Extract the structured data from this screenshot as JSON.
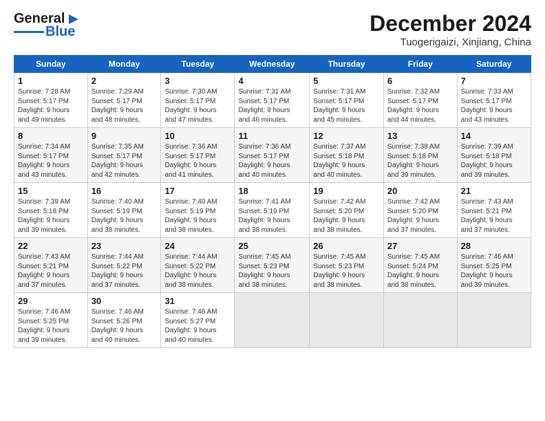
{
  "header": {
    "logo_general": "General",
    "logo_blue": "Blue",
    "title": "December 2024",
    "subtitle": "Tuogerigaizi, Xinjiang, China"
  },
  "calendar": {
    "days_of_week": [
      "Sunday",
      "Monday",
      "Tuesday",
      "Wednesday",
      "Thursday",
      "Friday",
      "Saturday"
    ],
    "weeks": [
      [
        {
          "day": "1",
          "info": "Sunrise: 7:28 AM\nSunset: 5:17 PM\nDaylight: 9 hours\nand 49 minutes."
        },
        {
          "day": "2",
          "info": "Sunrise: 7:29 AM\nSunset: 5:17 PM\nDaylight: 9 hours\nand 48 minutes."
        },
        {
          "day": "3",
          "info": "Sunrise: 7:30 AM\nSunset: 5:17 PM\nDaylight: 9 hours\nand 47 minutes."
        },
        {
          "day": "4",
          "info": "Sunrise: 7:31 AM\nSunset: 5:17 PM\nDaylight: 9 hours\nand 46 minutes."
        },
        {
          "day": "5",
          "info": "Sunrise: 7:31 AM\nSunset: 5:17 PM\nDaylight: 9 hours\nand 45 minutes."
        },
        {
          "day": "6",
          "info": "Sunrise: 7:32 AM\nSunset: 5:17 PM\nDaylight: 9 hours\nand 44 minutes."
        },
        {
          "day": "7",
          "info": "Sunrise: 7:33 AM\nSunset: 5:17 PM\nDaylight: 9 hours\nand 43 minutes."
        }
      ],
      [
        {
          "day": "8",
          "info": "Sunrise: 7:34 AM\nSunset: 5:17 PM\nDaylight: 9 hours\nand 43 minutes."
        },
        {
          "day": "9",
          "info": "Sunrise: 7:35 AM\nSunset: 5:17 PM\nDaylight: 9 hours\nand 42 minutes."
        },
        {
          "day": "10",
          "info": "Sunrise: 7:36 AM\nSunset: 5:17 PM\nDaylight: 9 hours\nand 41 minutes."
        },
        {
          "day": "11",
          "info": "Sunrise: 7:36 AM\nSunset: 5:17 PM\nDaylight: 9 hours\nand 40 minutes."
        },
        {
          "day": "12",
          "info": "Sunrise: 7:37 AM\nSunset: 5:18 PM\nDaylight: 9 hours\nand 40 minutes."
        },
        {
          "day": "13",
          "info": "Sunrise: 7:38 AM\nSunset: 5:18 PM\nDaylight: 9 hours\nand 39 minutes."
        },
        {
          "day": "14",
          "info": "Sunrise: 7:39 AM\nSunset: 5:18 PM\nDaylight: 9 hours\nand 39 minutes."
        }
      ],
      [
        {
          "day": "15",
          "info": "Sunrise: 7:39 AM\nSunset: 5:18 PM\nDaylight: 9 hours\nand 39 minutes."
        },
        {
          "day": "16",
          "info": "Sunrise: 7:40 AM\nSunset: 5:19 PM\nDaylight: 9 hours\nand 38 minutes."
        },
        {
          "day": "17",
          "info": "Sunrise: 7:40 AM\nSunset: 5:19 PM\nDaylight: 9 hours\nand 38 minutes."
        },
        {
          "day": "18",
          "info": "Sunrise: 7:41 AM\nSunset: 5:19 PM\nDaylight: 9 hours\nand 38 minutes."
        },
        {
          "day": "19",
          "info": "Sunrise: 7:42 AM\nSunset: 5:20 PM\nDaylight: 9 hours\nand 38 minutes."
        },
        {
          "day": "20",
          "info": "Sunrise: 7:42 AM\nSunset: 5:20 PM\nDaylight: 9 hours\nand 37 minutes."
        },
        {
          "day": "21",
          "info": "Sunrise: 7:43 AM\nSunset: 5:21 PM\nDaylight: 9 hours\nand 37 minutes."
        }
      ],
      [
        {
          "day": "22",
          "info": "Sunrise: 7:43 AM\nSunset: 5:21 PM\nDaylight: 9 hours\nand 37 minutes."
        },
        {
          "day": "23",
          "info": "Sunrise: 7:44 AM\nSunset: 5:22 PM\nDaylight: 9 hours\nand 37 minutes."
        },
        {
          "day": "24",
          "info": "Sunrise: 7:44 AM\nSunset: 5:22 PM\nDaylight: 9 hours\nand 38 minutes."
        },
        {
          "day": "25",
          "info": "Sunrise: 7:45 AM\nSunset: 5:23 PM\nDaylight: 9 hours\nand 38 minutes."
        },
        {
          "day": "26",
          "info": "Sunrise: 7:45 AM\nSunset: 5:23 PM\nDaylight: 9 hours\nand 38 minutes."
        },
        {
          "day": "27",
          "info": "Sunrise: 7:45 AM\nSunset: 5:24 PM\nDaylight: 9 hours\nand 38 minutes."
        },
        {
          "day": "28",
          "info": "Sunrise: 7:46 AM\nSunset: 5:25 PM\nDaylight: 9 hours\nand 39 minutes."
        }
      ],
      [
        {
          "day": "29",
          "info": "Sunrise: 7:46 AM\nSunset: 5:25 PM\nDaylight: 9 hours\nand 39 minutes."
        },
        {
          "day": "30",
          "info": "Sunrise: 7:46 AM\nSunset: 5:26 PM\nDaylight: 9 hours\nand 40 minutes."
        },
        {
          "day": "31",
          "info": "Sunrise: 7:46 AM\nSunset: 5:27 PM\nDaylight: 9 hours\nand 40 minutes."
        },
        {
          "day": "",
          "info": ""
        },
        {
          "day": "",
          "info": ""
        },
        {
          "day": "",
          "info": ""
        },
        {
          "day": "",
          "info": ""
        }
      ]
    ]
  }
}
